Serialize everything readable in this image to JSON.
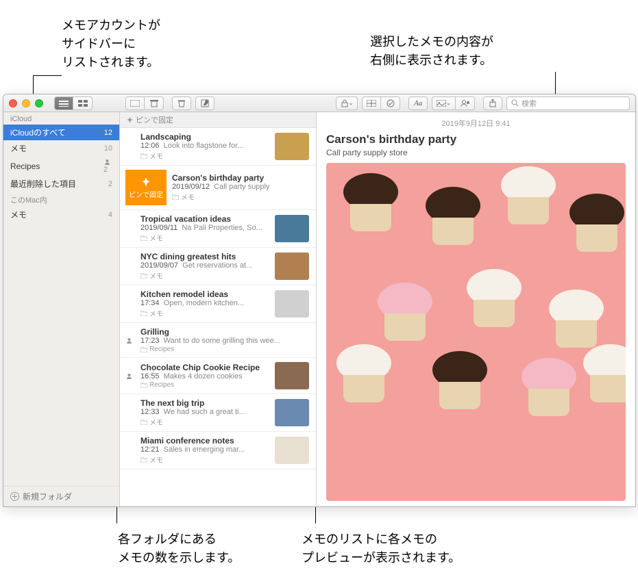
{
  "callouts": {
    "top_left": "メモアカウントが\nサイドバーに\nリストされます。",
    "top_right": "選択したメモの内容が\n右側に表示されます。",
    "bottom_left": "各フォルダにある\nメモの数を示します。",
    "bottom_right": "メモのリストに各メモの\nプレビューが表示されます。"
  },
  "toolbar": {
    "search_placeholder": "検索"
  },
  "sidebar": {
    "section_icloud": "iCloud",
    "section_mac": "このMac内",
    "items_icloud": [
      {
        "label": "iCloudのすべて",
        "count": "12",
        "selected": true
      },
      {
        "label": "メモ",
        "count": "10"
      },
      {
        "label": "Recipes",
        "count": "2",
        "shared": true
      },
      {
        "label": "最近削除した項目",
        "count": "2"
      }
    ],
    "items_mac": [
      {
        "label": "メモ",
        "count": "4"
      }
    ],
    "new_folder": "新規フォルダ"
  },
  "list": {
    "pinned_header": "ピンで固定",
    "pin_label": "ピンで固定",
    "notes": [
      {
        "title": "Landscaping",
        "time": "12:06",
        "preview": "Look into flagstone for...",
        "folder": "メモ",
        "thumb": "#c9a050"
      },
      {
        "title": "Carson's birthday party",
        "time": "2019/09/12",
        "preview": "Call party supply",
        "folder": "メモ",
        "selected": true
      },
      {
        "title": "Tropical vacation ideas",
        "time": "2019/09/11",
        "preview": "Na Pali Properties, So...",
        "folder": "メモ",
        "thumb": "#4a7a9a"
      },
      {
        "title": "NYC dining greatest hits",
        "time": "2019/09/07",
        "preview": "Get reservations at...",
        "folder": "メモ",
        "thumb": "#b08050"
      },
      {
        "title": "Kitchen remodel ideas",
        "time": "17:34",
        "preview": "Open, modern kitchen...",
        "folder": "メモ",
        "thumb": "#d0d0d0"
      },
      {
        "title": "Grilling",
        "time": "17:23",
        "preview": "Want to do some grilling this wee...",
        "folder": "Recipes",
        "shared": true
      },
      {
        "title": "Chocolate Chip Cookie Recipe",
        "time": "16:55",
        "preview": "Makes 4 dozen cookies",
        "folder": "Recipes",
        "shared": true,
        "thumb": "#8a6a50"
      },
      {
        "title": "The next big trip",
        "time": "12:33",
        "preview": "We had such a great ti...",
        "folder": "メモ",
        "thumb": "#6a8ab0"
      },
      {
        "title": "Miami conference notes",
        "time": "12:21",
        "preview": "Sales in emerging mar...",
        "folder": "メモ",
        "thumb": "#e8e0d0"
      }
    ]
  },
  "detail": {
    "date": "2019年9月12日 9:41",
    "title": "Carson's birthday party",
    "body": "Call party supply store"
  }
}
